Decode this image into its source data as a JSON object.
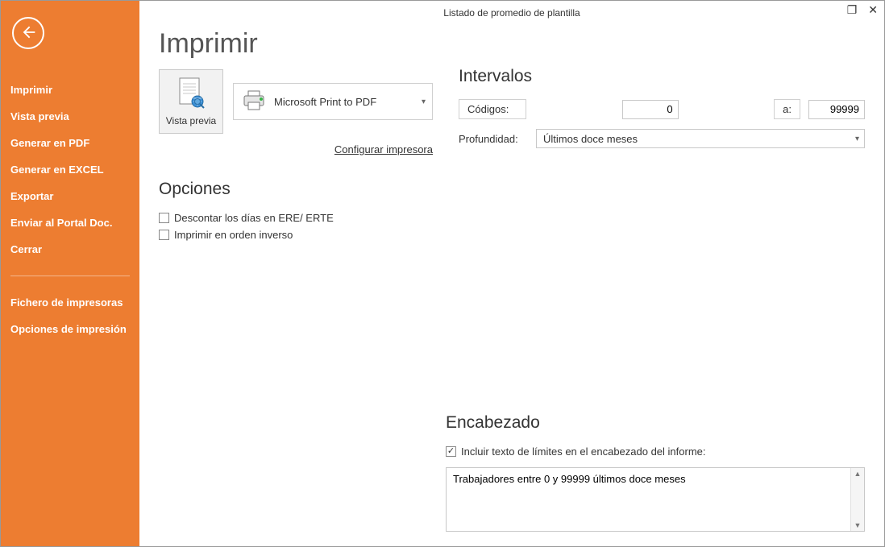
{
  "window": {
    "title": "Listado de promedio de plantilla"
  },
  "sidebar": {
    "items": [
      {
        "label": "Imprimir"
      },
      {
        "label": "Vista previa"
      },
      {
        "label": "Generar en PDF"
      },
      {
        "label": "Generar en EXCEL"
      },
      {
        "label": "Exportar"
      },
      {
        "label": "Enviar al Portal Doc."
      },
      {
        "label": "Cerrar"
      }
    ],
    "secondary": [
      {
        "label": "Fichero de impresoras"
      },
      {
        "label": "Opciones de impresión"
      }
    ]
  },
  "main": {
    "title": "Imprimir",
    "vista_previa_label": "Vista previa",
    "printer_name": "Microsoft Print to PDF",
    "config_link": "Configurar impresora",
    "opciones_title": "Opciones",
    "opciones": {
      "descontar_label": "Descontar los días en ERE/ ERTE",
      "descontar_checked": false,
      "inverse_label": "Imprimir en orden inverso",
      "inverse_checked": false
    }
  },
  "intervalos": {
    "title": "Intervalos",
    "codigos_label": "Códigos:",
    "codigo_from": "0",
    "a_label": "a:",
    "codigo_to": "99999",
    "profundidad_label": "Profundidad:",
    "profundidad_value": "Últimos doce meses"
  },
  "encabezado": {
    "title": "Encabezado",
    "incluir_label": "Incluir texto de límites en el encabezado del informe:",
    "incluir_checked": true,
    "text": "Trabajadores entre 0 y 99999 últimos doce meses"
  }
}
